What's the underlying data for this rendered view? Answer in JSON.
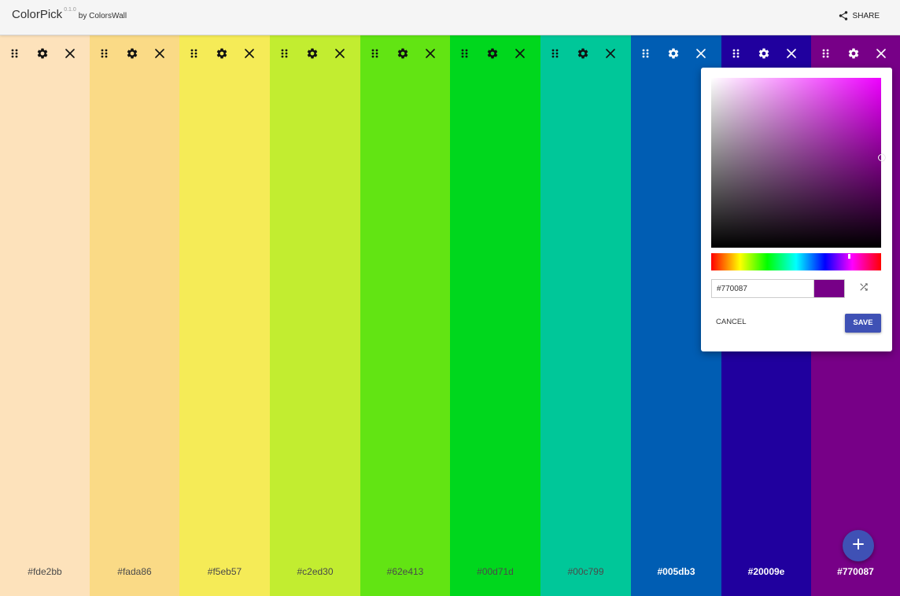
{
  "header": {
    "app_name": "ColorPick",
    "version": "0.1.0",
    "byline": "by ColorsWall",
    "share_label": "SHARE"
  },
  "palette": {
    "columns": [
      {
        "hex": "#fde2bb",
        "text_style": "light"
      },
      {
        "hex": "#fada86",
        "text_style": "light"
      },
      {
        "hex": "#f5eb57",
        "text_style": "light"
      },
      {
        "hex": "#c2ed30",
        "text_style": "light"
      },
      {
        "hex": "#62e413",
        "text_style": "light"
      },
      {
        "hex": "#00d71d",
        "text_style": "light"
      },
      {
        "hex": "#00c799",
        "text_style": "light"
      },
      {
        "hex": "#005db3",
        "text_style": "dark"
      },
      {
        "hex": "#20009e",
        "text_style": "dark"
      },
      {
        "hex": "#770087",
        "text_style": "dark"
      }
    ],
    "column_icons": [
      "drag-handle-icon",
      "gear-icon",
      "close-icon"
    ]
  },
  "picker": {
    "hex_value": "#770087",
    "swatch_color": "#770087",
    "cancel_label": "CANCEL",
    "save_label": "SAVE",
    "hue_color": "#ee00ff",
    "icons": [
      "shuffle-icon"
    ]
  },
  "fab": {
    "icon": "plus-icon",
    "color": "#3f51b5"
  },
  "colors": {
    "accent": "#3f51b5",
    "topbar": "#f5f5f5"
  }
}
